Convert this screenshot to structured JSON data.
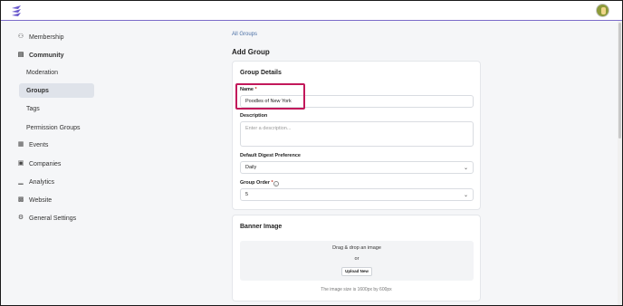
{
  "app": {
    "accent_color": "#7b6cc9",
    "logo_icon": "bolt-logo-icon",
    "avatar_icon": "user-avatar"
  },
  "sidebar": {
    "items": [
      {
        "label": "Membership",
        "icon": "users-icon"
      },
      {
        "label": "Community",
        "icon": "book-icon"
      },
      {
        "label": "Moderation"
      },
      {
        "label": "Groups"
      },
      {
        "label": "Tags"
      },
      {
        "label": "Permission Groups"
      },
      {
        "label": "Events",
        "icon": "calendar-icon"
      },
      {
        "label": "Companies",
        "icon": "briefcase-icon"
      },
      {
        "label": "Analytics",
        "icon": "chart-icon"
      },
      {
        "label": "Website",
        "icon": "browser-icon"
      },
      {
        "label": "General Settings",
        "icon": "gear-icon"
      }
    ],
    "active_item": "Groups"
  },
  "main": {
    "breadcrumb": "All Groups",
    "title": "Add Group",
    "details_card": {
      "title": "Group Details",
      "name_label": "Name",
      "required_mark": "*",
      "name_value": "Poodles of New York",
      "description_label": "Description",
      "description_placeholder": "Enter a description...",
      "digest_label": "Default Digest Preference",
      "digest_value": "Daily",
      "order_label": "Group Order",
      "order_info": "i",
      "order_value": "5"
    },
    "banner_card": {
      "title": "Banner Image",
      "drag_text": "Drag & drop an image",
      "or_text": "or",
      "upload_label": "Upload New",
      "size_note": "The image size is 1600px by 600px"
    }
  }
}
